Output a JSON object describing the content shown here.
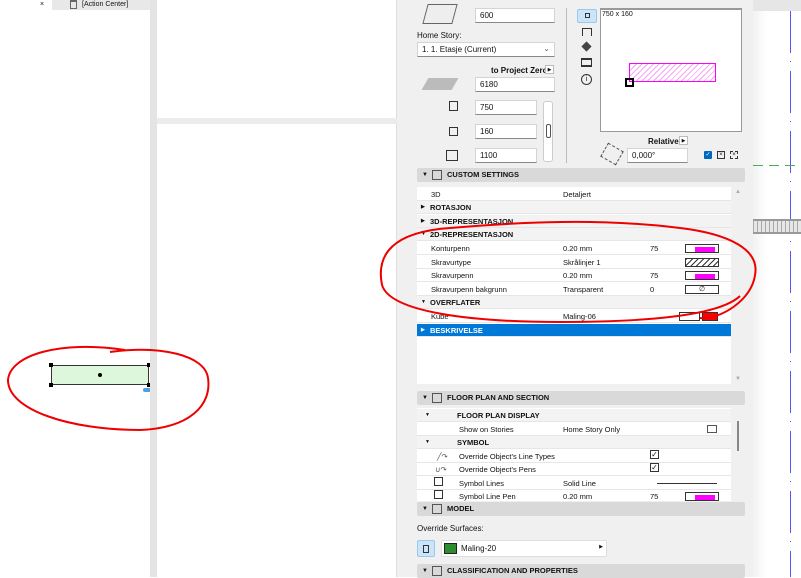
{
  "tab": {
    "close": "×",
    "label": "[Action Center]"
  },
  "geometry": {
    "height_top": "600",
    "home_story_label": "Home Story:",
    "home_story_value": "1. 1. Etasje (Current)",
    "to_project_zero": "to Project Zero",
    "elevation": "6180",
    "width": "750",
    "depth": "160",
    "height": "1100"
  },
  "preview": {
    "size": "750 x 160",
    "relative": "Relative",
    "angle": "0,000°"
  },
  "custom_settings": {
    "title": "CUSTOM SETTINGS",
    "rows": [
      {
        "name": "3D",
        "value": "Detaljert",
        "type": "param"
      },
      {
        "name": "ROTASJON",
        "type": "group-collapsed"
      },
      {
        "name": "3D-REPRESENTASJON",
        "type": "group-collapsed"
      },
      {
        "name": "2D-REPRESENTASJON",
        "type": "group-open"
      },
      {
        "name": "Konturpenn",
        "value": "0.20 mm",
        "num": "75",
        "swatch": "pen"
      },
      {
        "name": "Skravurtype",
        "value": "Skrålinjer 1",
        "swatch": "hatch"
      },
      {
        "name": "Skravurpenn",
        "value": "0.20 mm",
        "num": "75",
        "swatch": "pen"
      },
      {
        "name": "Skravurpenn bakgrunn",
        "value": "Transparent",
        "num": "0",
        "swatch": "empty"
      },
      {
        "name": "OVERFLATER",
        "type": "group-open"
      },
      {
        "name": "Kube",
        "value": "Maling-06",
        "swatch": "surface"
      },
      {
        "name": "BESKRIVELSE",
        "type": "group-selected"
      }
    ]
  },
  "floor_plan": {
    "title": "FLOOR PLAN AND SECTION",
    "display": "FLOOR PLAN DISPLAY",
    "show_on_stories": "Show on Stories",
    "show_value": "Home Story Only",
    "symbol": "SYMBOL",
    "override_line_types": "Override Object's Line Types",
    "override_pens": "Override Object's Pens",
    "symbol_lines": "Symbol Lines",
    "symbol_lines_value": "Solid Line",
    "symbol_line_pen": "Symbol Line Pen",
    "symbol_line_pen_value": "0.20 mm",
    "symbol_line_pen_num": "75"
  },
  "model": {
    "title": "MODEL",
    "override_surfaces": "Override Surfaces:",
    "surface": "Maling-20",
    "surface_color": "#2e8b2e"
  },
  "classification": {
    "title": "CLASSIFICATION AND PROPERTIES"
  },
  "colors": {
    "accent": "#0078d7",
    "pen": "#ff00ff",
    "annotation": "#e00000",
    "kube_color": "#ff0000"
  }
}
